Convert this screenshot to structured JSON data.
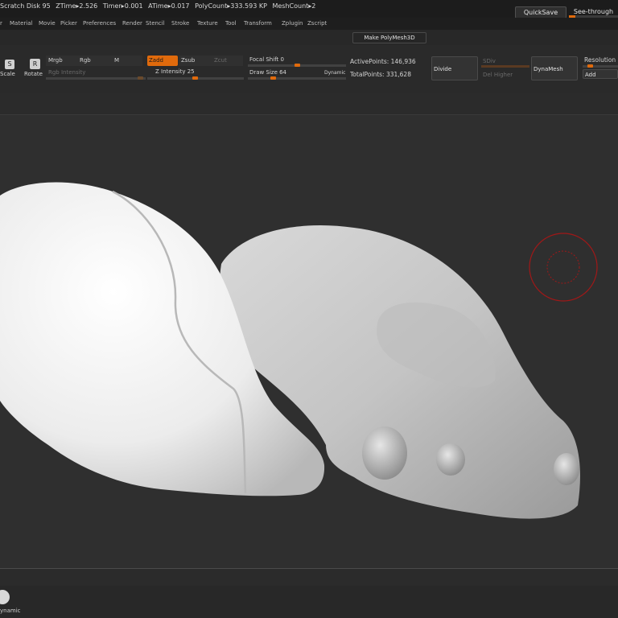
{
  "status": {
    "scratch_disk": "Scratch Disk 95",
    "ztime": "ZTime▸2.526",
    "timer": "Timer▸0.001",
    "atime": "ATime▸0.017",
    "polycount": "PolyCount▸333.593 KP",
    "meshcount": "MeshCount▸2"
  },
  "top_buttons": {
    "quicksave": "QuickSave",
    "see_through": "See-through"
  },
  "menu": [
    "r",
    "Material",
    "Movie",
    "Picker",
    "Preferences",
    "Render",
    "Stencil",
    "Stroke",
    "Texture",
    "Tool",
    "Transform",
    "Zplugin",
    "Zscript"
  ],
  "palette": {
    "make_polymesh": "Make PolyMesh3D"
  },
  "toolbar": {
    "scale": "Scale",
    "rotate": "Rotate",
    "mrgb": "Mrgb",
    "rgb": "Rgb",
    "m": "M",
    "zadd": "Zadd",
    "zsub": "Zsub",
    "zcut": "Zcut",
    "rgb_intensity": "Rgb Intensity",
    "z_intensity": "Z Intensity 25",
    "focal_shift": "Focal Shift 0",
    "draw_size": "Draw Size 64",
    "dynamic": "Dynamic",
    "active_points": "ActivePoints: 146,936",
    "total_points": "TotalPoints: 331,628",
    "divide": "Divide",
    "sdiv": "SDiv",
    "del_higher": "Del Higher",
    "dynamesh": "DynaMesh",
    "resolution": "Resolution",
    "add": "Add"
  },
  "bottom": {
    "dynamic_label": "ynamic"
  },
  "colors": {
    "accent": "#e06a0c",
    "brush_ring": "#a01818"
  }
}
